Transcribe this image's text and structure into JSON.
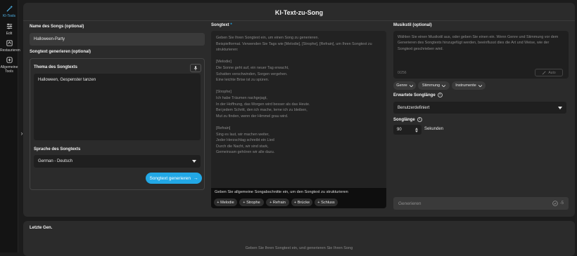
{
  "sidebar": {
    "items": [
      {
        "label": "KI-Tools",
        "icon": "magic-wand-icon",
        "active": true
      },
      {
        "label": "Edit",
        "icon": "sliders-icon",
        "active": false
      },
      {
        "label": "Restaurieren",
        "icon": "restore-icon",
        "active": false
      },
      {
        "label": "Allgemeine Tools",
        "icon": "tools-icon",
        "active": false
      }
    ],
    "collapse_glyph": "›"
  },
  "header": {
    "title": "KI-Text-zu-Song"
  },
  "left": {
    "song_name_label": "Name des Songs (optional)",
    "song_name_value": "Halloween-Party",
    "generate_lyrics_label": "Songtext generieren (optional)",
    "topic_label": "Thema des Songtexts",
    "topic_value": "Halloween, Gespenster tanzen",
    "language_label": "Sprache des Songtexts",
    "language_value": "German - Deutsch",
    "generate_button": "Songtext generieren",
    "generate_arrow": "→"
  },
  "middle": {
    "lyrics_label": "Songtext",
    "required_mark": "*",
    "lyrics_placeholder": "Geben Sie Ihren Songtext ein, um einen Song zu generieren.\nBeispielformat. Verwenden Sie Tags wie [Melodie], [Strophe], [Refrain], um Ihren Songtext zu strukturieren:\n\n[Melodie]\nDie Sonne geht auf, ein neuer Tag erwacht,\nSchatten verschwinden, Sorgen vergehen.\nEine leichte Brise ist zu spüren.\n\n[Strophe]\nIch habe Träumen nachgejagt,\nIn der Hoffnung, das Morgen wird besser als das Heute.\nBei jedem Schritt, den ich mache, lerne ich zu bleiben,\nMut zu finden, wenn der Himmel grau wird.\n\n[Refrain]\nSing es laut, wir machen weiter,\nJeder Herzschlag schreibt ein Lied\nDurch die Nacht, wir sind stark,\nGemeinsam gehören wir alle dazu.",
    "footer_hint": "Geben Sie allgemeine Songabschnitte ein, um den Songtext zu strukturieren",
    "chips": [
      "+ Melodie",
      "+ Strophe",
      "+ Refrain",
      "+ Brücke",
      "+ Schluss"
    ]
  },
  "right": {
    "style_label": "Musikstil (optional)",
    "style_placeholder": "Wählen Sie einen Musikstil aus, oder geben Sie einen ein. Wenn Genre und Stimmung vor dem Generieren des Songtexts hinzugefügt werden, beeinflusst dies die Art und Weise, wie der Songtext geschrieben wird.",
    "style_counter": "0/256",
    "auto_button": "Auto",
    "filters": [
      "Genre",
      "Stimmung",
      "Instrumente"
    ],
    "length_label": "Erwartete Songlänge",
    "length_value": "Benutzerdefiniert",
    "duration_label": "Songlänge",
    "duration_value": "90",
    "duration_unit": "Sekunden",
    "generate_button": "Generieren",
    "credit_cost": "-5"
  },
  "recent": {
    "title": "Letzte Gen.",
    "empty_text": "Geben Sie Ihren Songtext ein, und generieren Sie Ihren Song"
  },
  "colors": {
    "accent": "#22a8e6",
    "panel": "#2b2b2b",
    "background": "#1c1c1c"
  }
}
